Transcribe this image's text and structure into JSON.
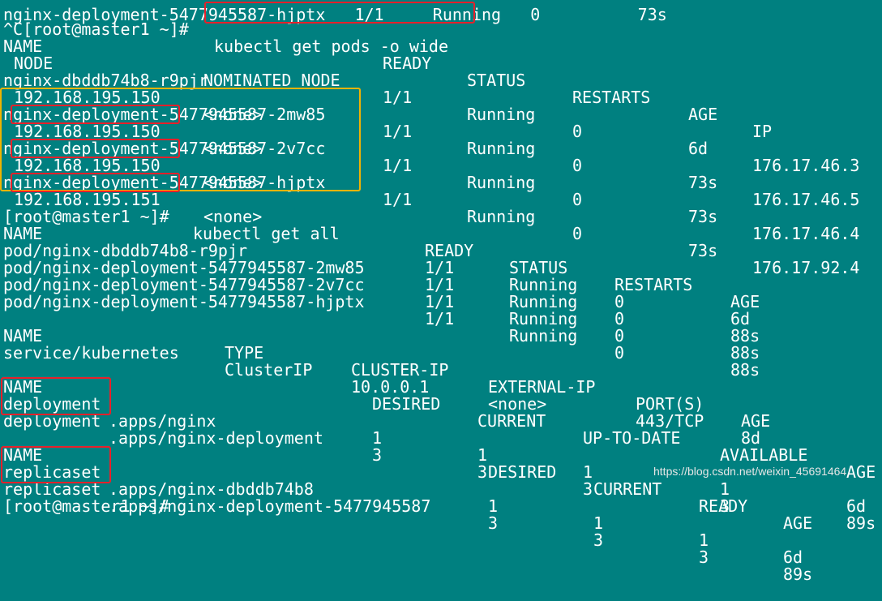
{
  "terminal": {
    "top_partial": "nginx-deployment-5477945587-hjptx   1/1     Running   0          73s",
    "cmd1_prompt": "^C[root@master1 ~]#",
    "cmd1_command": "kubectl get pods -o wide",
    "pods_header1": [
      "NAME",
      "READY",
      "STATUS",
      "RESTARTS",
      "AGE",
      "IP"
    ],
    "pods_header2": [
      "NODE",
      "NOMINATED NODE"
    ],
    "pods": [
      {
        "name": "nginx-dbddb74b8-r9pjr",
        "ready": "1/1",
        "status": "Running",
        "restarts": "0",
        "age": "6d",
        "ip": "176.17.46.3",
        "node": "192.168.195.150",
        "nominated": "<none>"
      },
      {
        "name": "nginx-deployment-5477945587-2mw85",
        "ready": "1/1",
        "status": "Running",
        "restarts": "0",
        "age": "73s",
        "ip": "176.17.46.5",
        "node": "192.168.195.150",
        "nominated": "<none>"
      },
      {
        "name": "nginx-deployment-5477945587-2v7cc",
        "ready": "1/1",
        "status": "Running",
        "restarts": "0",
        "age": "73s",
        "ip": "176.17.46.4",
        "node": "192.168.195.150",
        "nominated": "<none>"
      },
      {
        "name": "nginx-deployment-5477945587-hjptx",
        "ready": "1/1",
        "status": "Running",
        "restarts": "0",
        "age": "73s",
        "ip": "176.17.92.4",
        "node": "192.168.195.151",
        "nominated": "<none>"
      }
    ],
    "cmd2_prompt": "[root@master1 ~]#",
    "cmd2_command": "kubectl get all",
    "all_pods_header": [
      "NAME",
      "READY",
      "STATUS",
      "RESTARTS",
      "AGE"
    ],
    "all_pods": [
      {
        "name": "pod/nginx-dbddb74b8-r9pjr",
        "ready": "1/1",
        "status": "Running",
        "restarts": "0",
        "age": "6d"
      },
      {
        "name": "pod/nginx-deployment-5477945587-2mw85",
        "ready": "1/1",
        "status": "Running",
        "restarts": "0",
        "age": "88s"
      },
      {
        "name": "pod/nginx-deployment-5477945587-2v7cc",
        "ready": "1/1",
        "status": "Running",
        "restarts": "0",
        "age": "88s"
      },
      {
        "name": "pod/nginx-deployment-5477945587-hjptx",
        "ready": "1/1",
        "status": "Running",
        "restarts": "0",
        "age": "88s"
      }
    ],
    "svc_header": [
      "NAME",
      "TYPE",
      "CLUSTER-IP",
      "EXTERNAL-IP",
      "PORT(S)",
      "AGE"
    ],
    "svc": {
      "name": "service/kubernetes",
      "type": "ClusterIP",
      "cluster_ip": "10.0.0.1",
      "external_ip": "<none>",
      "ports": "443/TCP",
      "age": "8d"
    },
    "deploy_header": [
      "NAME",
      "DESIRED",
      "CURRENT",
      "UP-TO-DATE",
      "AVAILABLE",
      "AGE"
    ],
    "deploys": [
      {
        "kind": "deployment",
        "rest": ".apps/nginx",
        "desired": "1",
        "current": "1",
        "uptodate": "1",
        "available": "1",
        "age": "6d"
      },
      {
        "kind": "deployment",
        "rest": ".apps/nginx-deployment",
        "desired": "3",
        "current": "3",
        "uptodate": "3",
        "available": "3",
        "age": "89s"
      }
    ],
    "rs_header": [
      "NAME",
      "DESIRED",
      "CURRENT",
      "READY",
      "AGE"
    ],
    "rs": [
      {
        "kind": "replicaset",
        "rest": ".apps/nginx-dbddb74b8",
        "desired": "1",
        "current": "1",
        "ready": "1",
        "age": "6d"
      },
      {
        "kind": "replicaset",
        "rest": ".apps/nginx-deployment-5477945587",
        "desired": "3",
        "current": "3",
        "ready": "3",
        "age": "89s"
      }
    ],
    "last_prompt": "[root@master1 ~]#"
  },
  "watermark": "https://blog.csdn.net/weixin_45691464",
  "colors": {
    "background": "#008080",
    "text": "#ffffff",
    "highlight_red": "#e8202a",
    "highlight_yellow": "#f0b400"
  }
}
